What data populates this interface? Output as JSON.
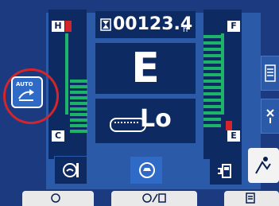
{
  "hour_meter": {
    "value": "00123.4",
    "unit": "h"
  },
  "mode": {
    "letter": "E"
  },
  "travel_speed": {
    "label": "Lo"
  },
  "coolant_gauge": {
    "top_tag": "H",
    "bottom_tag": "C"
  },
  "fuel_gauge": {
    "top_tag": "F",
    "bottom_tag": "E"
  },
  "auto_deceleration": {
    "label": "AUTO"
  },
  "colors": {
    "background": "#1b3a80",
    "panel": "#2b5aa8",
    "gauge_green": "#1fb36a",
    "gauge_red": "#d3262b",
    "highlight_ring": "#d3262b"
  }
}
